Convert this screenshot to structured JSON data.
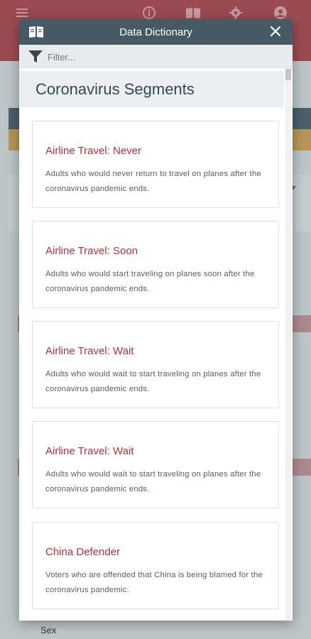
{
  "background": {
    "bg_field_label": "Sex"
  },
  "modal": {
    "title": "Data Dictionary",
    "filter": {
      "placeholder": "Filter...",
      "value": ""
    },
    "section_title": "Coronavirus Segments",
    "entries": [
      {
        "title": "Airline Travel: Never",
        "description": "Adults who would never return to travel on planes after the coronavirus pandemic ends."
      },
      {
        "title": "Airline Travel: Soon",
        "description": "Adults who would start traveling on planes soon after the coronavirus pandemic ends."
      },
      {
        "title": "Airline Travel: Wait",
        "description": "Adults who would wait to start traveling on planes after the coronavirus pandemic ends."
      },
      {
        "title": "Airline Travel: Wait",
        "description": "Adults who would wait to start traveling on planes after the coronavirus pandemic ends."
      },
      {
        "title": "China Defender",
        "description": "Voters who are offended that China is being blamed for the coronavirus pandemic."
      }
    ]
  },
  "icons": {
    "topbar": [
      "menu-icon",
      "info-icon",
      "book-icon",
      "gear-icon",
      "account-icon"
    ],
    "modal": [
      "book-icon",
      "close-icon",
      "filter-icon"
    ]
  },
  "colors": {
    "header": "#455a64",
    "entry_title": "#b5303a",
    "topbar_bg": "#9b4a52"
  }
}
